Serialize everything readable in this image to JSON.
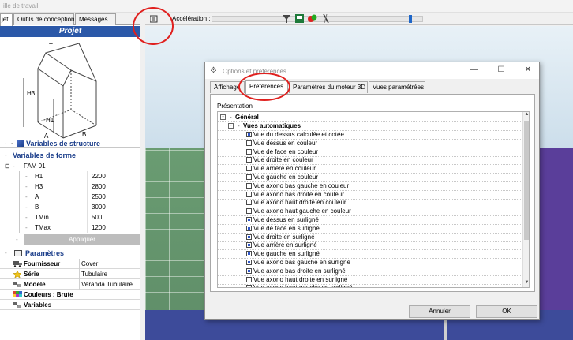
{
  "window": {
    "title_fragment": "ille de travail"
  },
  "left_panel": {
    "tabs": [
      "jet",
      "Outils de conception",
      "Messages"
    ],
    "header": "Projet",
    "diagram_labels": [
      "T",
      "H3",
      "H1",
      "A",
      "B"
    ],
    "section_structure": "Variables de structure",
    "section_forme": "Variables de forme",
    "family": "FAM 01",
    "variables": [
      {
        "name": "H1",
        "value": "2200"
      },
      {
        "name": "H3",
        "value": "2800"
      },
      {
        "name": "A",
        "value": "2500"
      },
      {
        "name": "B",
        "value": "3000"
      },
      {
        "name": "TMin",
        "value": "500"
      },
      {
        "name": "TMax",
        "value": "1200"
      }
    ],
    "apply_button": "Appliquer",
    "section_params": "Paramètres",
    "params": [
      {
        "label": "Fournisseur",
        "value": "Cover",
        "icon": "truck-icon"
      },
      {
        "label": "Série",
        "value": "Tubulaire",
        "icon": "star-icon"
      },
      {
        "label": "Modèle",
        "value": "Veranda Tubulaire",
        "icon": "model-icon"
      },
      {
        "label": "Couleurs : Brute",
        "value": "",
        "icon": "palette-icon"
      },
      {
        "label": "Variables",
        "value": "",
        "icon": "variables-icon"
      }
    ]
  },
  "toolbar": {
    "acceleration_label": "Accélération :",
    "slider_level": 0.95
  },
  "dialog": {
    "title": "Options et préférences",
    "tabs": [
      "Affichage",
      "Préférences",
      "Paramètres du moteur 3D",
      "Vues paramétrées"
    ],
    "active_tab": "Préférences",
    "group_label": "Présentation",
    "tree_root": "Général",
    "tree_sub": "Vues automatiques",
    "items": [
      {
        "label": "Vue du dessus calculée et cotée",
        "checked": true
      },
      {
        "label": "Vue dessus en couleur",
        "checked": false
      },
      {
        "label": "Vue de face en couleur",
        "checked": false
      },
      {
        "label": "Vue droite en couleur",
        "checked": false
      },
      {
        "label": "Vue arrière en couleur",
        "checked": false
      },
      {
        "label": "Vue gauche en couleur",
        "checked": false
      },
      {
        "label": "Vue axono bas gauche en couleur",
        "checked": false
      },
      {
        "label": "Vue axono bas droite en couleur",
        "checked": false
      },
      {
        "label": "Vue axono haut droite en couleur",
        "checked": false
      },
      {
        "label": "Vue axono haut gauche en couleur",
        "checked": false
      },
      {
        "label": "Vue dessus en surligné",
        "checked": true
      },
      {
        "label": "Vue de face en surligné",
        "checked": true
      },
      {
        "label": "Vue droite en surligné",
        "checked": true
      },
      {
        "label": "Vue arrière en surligné",
        "checked": true
      },
      {
        "label": "Vue gauche en surligné",
        "checked": true
      },
      {
        "label": "Vue axono bas gauche en surligné",
        "checked": true
      },
      {
        "label": "Vue axono bas droite en surligné",
        "checked": true
      },
      {
        "label": "Vue axono haut droite en surligné",
        "checked": false
      },
      {
        "label": "Vue axono haut gauche en surligné",
        "checked": false
      }
    ],
    "cancel_button": "Annuler",
    "ok_button": "OK"
  },
  "colors": {
    "header_blue": "#2b58a8",
    "section_text": "#1a3d8a",
    "annotation_red": "#e0201e",
    "checkbox_mark": "#2d55c9"
  }
}
